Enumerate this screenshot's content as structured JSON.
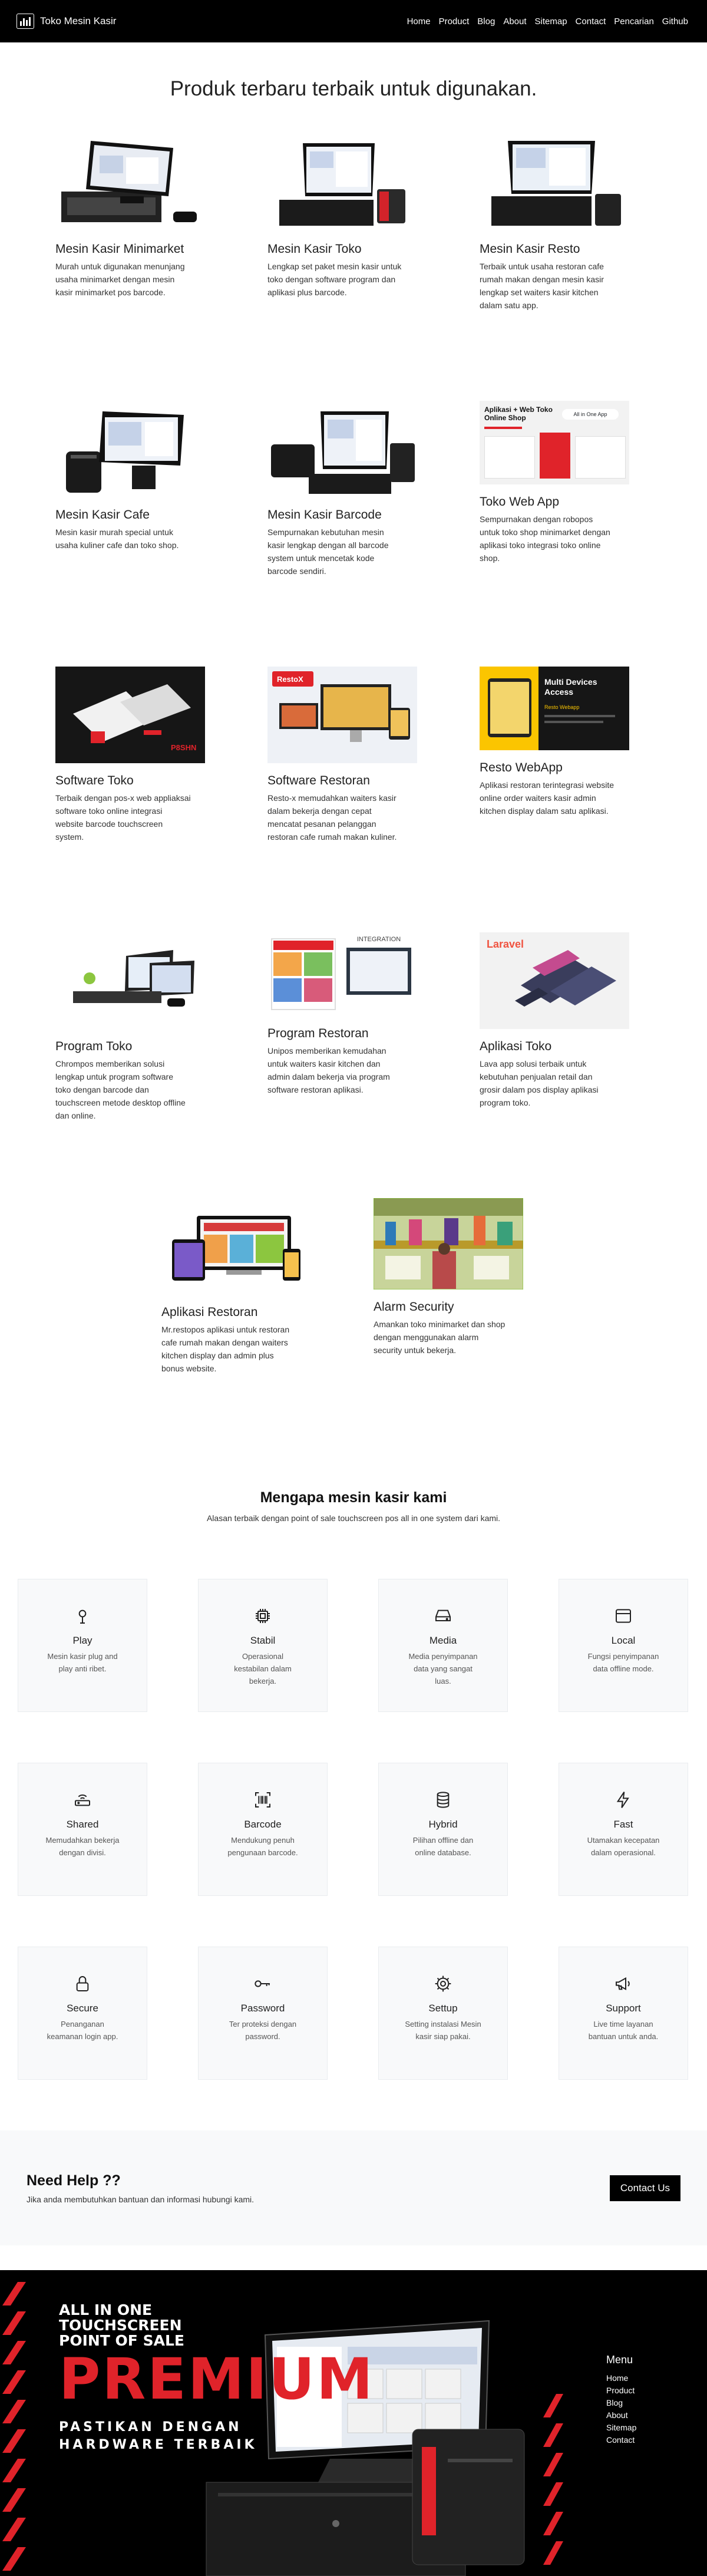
{
  "nav": {
    "brand": "Toko Mesin Kasir",
    "links": [
      "Home",
      "Product",
      "Blog",
      "About",
      "Sitemap",
      "Contact",
      "Pencarian",
      "Github"
    ]
  },
  "products": {
    "title": "Produk terbaru terbaik untuk digunakan.",
    "items": [
      {
        "title": "Mesin Kasir Minimarket",
        "text": "Murah untuk digunakan menunjang usaha minimarket dengan mesin kasir minimarket pos barcode."
      },
      {
        "title": "Mesin Kasir Toko",
        "text": "Lengkap set paket mesin kasir untuk toko dengan software program dan aplikasi plus barcode."
      },
      {
        "title": "Mesin Kasir Resto",
        "text": "Terbaik untuk usaha restoran cafe rumah makan dengan mesin kasir lengkap set waiters kasir kitchen dalam satu app."
      },
      {
        "title": "Mesin Kasir Cafe",
        "text": "Mesin kasir murah special untuk usaha kuliner cafe dan toko shop."
      },
      {
        "title": "Mesin Kasir Barcode",
        "text": "Sempurnakan kebutuhan mesin kasir lengkap dengan all barcode system untuk mencetak kode barcode sendiri."
      },
      {
        "title": "Toko Web App",
        "text": "Sempurnakan dengan robopos untuk toko shop minimarket dengan aplikasi toko integrasi toko online shop."
      },
      {
        "title": "Software Toko",
        "text": "Terbaik dengan pos-x web appliaksai software toko online integrasi website barcode touchscreen system."
      },
      {
        "title": "Software Restoran",
        "text": "Resto-x memudahkan waiters kasir dalam bekerja dengan cepat mencatat pesanan pelanggan restoran cafe rumah makan kuliner."
      },
      {
        "title": "Resto WebApp",
        "text": "Aplikasi restoran terintegrasi website online order waiters kasir admin kitchen display dalam satu aplikasi."
      },
      {
        "title": "Program Toko",
        "text": "Chrompos memberikan solusi lengkap untuk program software toko dengan barcode dan touchscreen metode desktop offline dan online."
      },
      {
        "title": "Program Restoran",
        "text": "Unipos memberikan kemudahan untuk waiters kasir kitchen dan admin dalam bekerja via program software restoran aplikasi."
      },
      {
        "title": "Aplikasi Toko",
        "text": "Lava app solusi terbaik untuk kebutuhan penjualan retail dan grosir dalam pos display aplikasi program toko."
      },
      {
        "title": "Aplikasi Restoran",
        "text": "Mr.restopos aplikasi untuk restoran cafe rumah makan dengan waiters kitchen display dan admin plus bonus website."
      },
      {
        "title": "Alarm Security",
        "text": "Amankan toko minimarket dan shop dengan menggunakan alarm security untuk bekerja."
      }
    ],
    "image_labels": {
      "webapp": "Aplikasi + Web Toko Online Shop",
      "webapp_badge": "All in One App",
      "pos_logo": "P8SHN",
      "resto_badge": "RestoX",
      "resto_devices": "Multi Devices Access",
      "resto_brand": "Resto Webapp",
      "integration": "INTEGRATION",
      "laravel": "Laravel"
    }
  },
  "why": {
    "title": "Mengapa mesin kasir kami",
    "subtitle": "Alasan terbaik dengan point of sale touchscreen pos all in one system dari kami.",
    "features": [
      {
        "title": "Play",
        "text": "Mesin kasir plug and play anti ribet.",
        "icon": "play-icon"
      },
      {
        "title": "Stabil",
        "text": "Operasional kestabilan dalam bekerja.",
        "icon": "cpu-icon"
      },
      {
        "title": "Media",
        "text": "Media penyimpanan data yang sangat luas.",
        "icon": "hdd-icon"
      },
      {
        "title": "Local",
        "text": "Fungsi penyimpanan data offline mode.",
        "icon": "window-icon"
      },
      {
        "title": "Shared",
        "text": "Memudahkan bekerja dengan divisi.",
        "icon": "router-icon"
      },
      {
        "title": "Barcode",
        "text": "Mendukung penuh pengunaan barcode.",
        "icon": "barcode-icon"
      },
      {
        "title": "Hybrid",
        "text": "Pilihan offline dan online database.",
        "icon": "database-icon"
      },
      {
        "title": "Fast",
        "text": "Utamakan kecepatan dalam operasional.",
        "icon": "lightning-icon"
      },
      {
        "title": "Secure",
        "text": "Penanganan keamanan login app.",
        "icon": "lock-icon"
      },
      {
        "title": "Password",
        "text": "Ter proteksi dengan password.",
        "icon": "key-icon"
      },
      {
        "title": "Settup",
        "text": "Setting instalasi Mesin kasir siap pakai.",
        "icon": "gear-icon"
      },
      {
        "title": "Support",
        "text": "Live time layanan bantuan untuk anda.",
        "icon": "megaphone-icon"
      }
    ]
  },
  "help": {
    "title": "Need Help ??",
    "text": "Jika anda membutuhkan bantuan dan informasi hubungi kami.",
    "button": "Contact Us"
  },
  "footer": {
    "ad_line1": "ALL IN ONE",
    "ad_line2": "TOUCHSCREEN",
    "ad_line3": "POINT OF SALE",
    "ad_big": "PREMIUM",
    "ad_line4": "PASTIKAN DENGAN",
    "ad_line5": "HARDWARE TERBAIK",
    "menu_title": "Menu",
    "menu_links": [
      "Home",
      "Product",
      "Blog",
      "About",
      "Sitemap",
      "Contact"
    ]
  },
  "colors": {
    "accent_red": "#e0232a",
    "navbar": "#000000",
    "card_bg": "#f8f9fa"
  }
}
